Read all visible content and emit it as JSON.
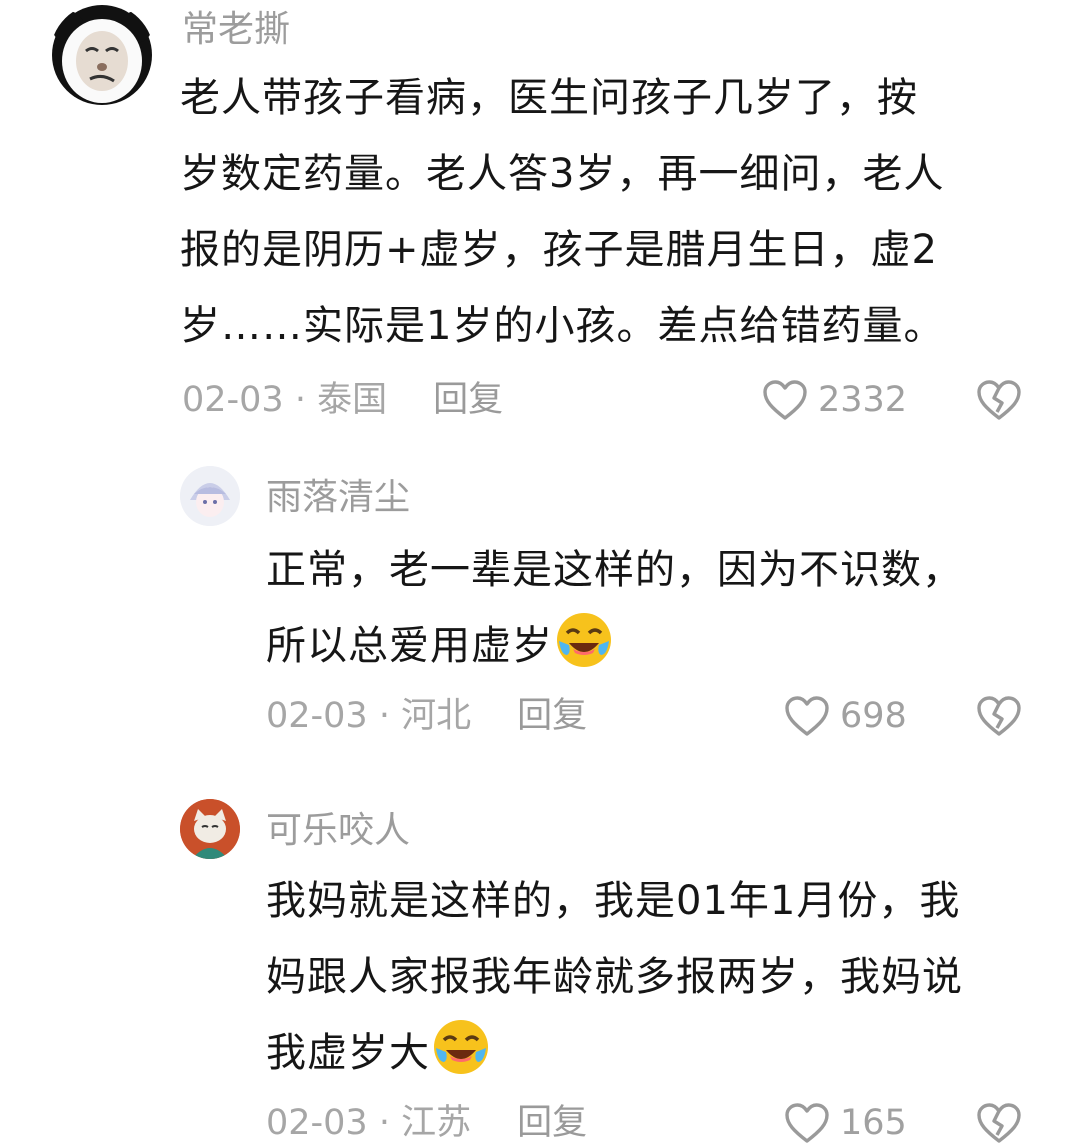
{
  "comments": [
    {
      "user": "常老撕",
      "avatar_icon": "panda-meme-avatar",
      "lines": [
        "老人带孩子看病，医生问孩子几岁了，按",
        "岁数定药量。老人答3岁，再一细问，老人",
        "报的是阴历+虚岁，孩子是腊月生日，虚2",
        "岁……实际是1岁的小孩。差点给错药量。"
      ],
      "date": "02-03",
      "location": "泰国",
      "reply_label": "回复",
      "likes": "2332"
    },
    {
      "user": "雨落清尘",
      "avatar_icon": "anime-girl-avatar",
      "lines": [
        "正常，老一辈是这样的，因为不识数，",
        "所以总爱用虚岁"
      ],
      "emoji": "laughing-tears-emoji",
      "date": "02-03",
      "location": "河北",
      "reply_label": "回复",
      "likes": "698"
    },
    {
      "user": "可乐咬人",
      "avatar_icon": "cat-avatar",
      "lines": [
        "我妈就是这样的，我是01年1月份，我",
        "妈跟人家报我年龄就多报两岁，我妈说",
        "我虚岁大"
      ],
      "emoji": "laughing-tears-emoji",
      "date": "02-03",
      "location": "江苏",
      "reply_label": "回复",
      "likes": "165"
    }
  ],
  "meta_separator": " · ",
  "colors": {
    "text": "#161616",
    "muted": "#a6a6a6",
    "accent_emoji": "#f5b400"
  }
}
